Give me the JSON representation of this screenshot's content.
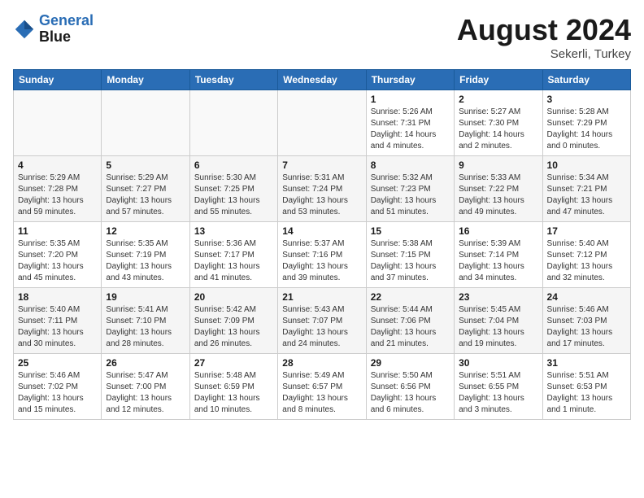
{
  "header": {
    "logo_line1": "General",
    "logo_line2": "Blue",
    "month_title": "August 2024",
    "subtitle": "Sekerli, Turkey"
  },
  "weekdays": [
    "Sunday",
    "Monday",
    "Tuesday",
    "Wednesday",
    "Thursday",
    "Friday",
    "Saturday"
  ],
  "weeks": [
    [
      {
        "day": "",
        "info": ""
      },
      {
        "day": "",
        "info": ""
      },
      {
        "day": "",
        "info": ""
      },
      {
        "day": "",
        "info": ""
      },
      {
        "day": "1",
        "info": "Sunrise: 5:26 AM\nSunset: 7:31 PM\nDaylight: 14 hours\nand 4 minutes."
      },
      {
        "day": "2",
        "info": "Sunrise: 5:27 AM\nSunset: 7:30 PM\nDaylight: 14 hours\nand 2 minutes."
      },
      {
        "day": "3",
        "info": "Sunrise: 5:28 AM\nSunset: 7:29 PM\nDaylight: 14 hours\nand 0 minutes."
      }
    ],
    [
      {
        "day": "4",
        "info": "Sunrise: 5:29 AM\nSunset: 7:28 PM\nDaylight: 13 hours\nand 59 minutes."
      },
      {
        "day": "5",
        "info": "Sunrise: 5:29 AM\nSunset: 7:27 PM\nDaylight: 13 hours\nand 57 minutes."
      },
      {
        "day": "6",
        "info": "Sunrise: 5:30 AM\nSunset: 7:25 PM\nDaylight: 13 hours\nand 55 minutes."
      },
      {
        "day": "7",
        "info": "Sunrise: 5:31 AM\nSunset: 7:24 PM\nDaylight: 13 hours\nand 53 minutes."
      },
      {
        "day": "8",
        "info": "Sunrise: 5:32 AM\nSunset: 7:23 PM\nDaylight: 13 hours\nand 51 minutes."
      },
      {
        "day": "9",
        "info": "Sunrise: 5:33 AM\nSunset: 7:22 PM\nDaylight: 13 hours\nand 49 minutes."
      },
      {
        "day": "10",
        "info": "Sunrise: 5:34 AM\nSunset: 7:21 PM\nDaylight: 13 hours\nand 47 minutes."
      }
    ],
    [
      {
        "day": "11",
        "info": "Sunrise: 5:35 AM\nSunset: 7:20 PM\nDaylight: 13 hours\nand 45 minutes."
      },
      {
        "day": "12",
        "info": "Sunrise: 5:35 AM\nSunset: 7:19 PM\nDaylight: 13 hours\nand 43 minutes."
      },
      {
        "day": "13",
        "info": "Sunrise: 5:36 AM\nSunset: 7:17 PM\nDaylight: 13 hours\nand 41 minutes."
      },
      {
        "day": "14",
        "info": "Sunrise: 5:37 AM\nSunset: 7:16 PM\nDaylight: 13 hours\nand 39 minutes."
      },
      {
        "day": "15",
        "info": "Sunrise: 5:38 AM\nSunset: 7:15 PM\nDaylight: 13 hours\nand 37 minutes."
      },
      {
        "day": "16",
        "info": "Sunrise: 5:39 AM\nSunset: 7:14 PM\nDaylight: 13 hours\nand 34 minutes."
      },
      {
        "day": "17",
        "info": "Sunrise: 5:40 AM\nSunset: 7:12 PM\nDaylight: 13 hours\nand 32 minutes."
      }
    ],
    [
      {
        "day": "18",
        "info": "Sunrise: 5:40 AM\nSunset: 7:11 PM\nDaylight: 13 hours\nand 30 minutes."
      },
      {
        "day": "19",
        "info": "Sunrise: 5:41 AM\nSunset: 7:10 PM\nDaylight: 13 hours\nand 28 minutes."
      },
      {
        "day": "20",
        "info": "Sunrise: 5:42 AM\nSunset: 7:09 PM\nDaylight: 13 hours\nand 26 minutes."
      },
      {
        "day": "21",
        "info": "Sunrise: 5:43 AM\nSunset: 7:07 PM\nDaylight: 13 hours\nand 24 minutes."
      },
      {
        "day": "22",
        "info": "Sunrise: 5:44 AM\nSunset: 7:06 PM\nDaylight: 13 hours\nand 21 minutes."
      },
      {
        "day": "23",
        "info": "Sunrise: 5:45 AM\nSunset: 7:04 PM\nDaylight: 13 hours\nand 19 minutes."
      },
      {
        "day": "24",
        "info": "Sunrise: 5:46 AM\nSunset: 7:03 PM\nDaylight: 13 hours\nand 17 minutes."
      }
    ],
    [
      {
        "day": "25",
        "info": "Sunrise: 5:46 AM\nSunset: 7:02 PM\nDaylight: 13 hours\nand 15 minutes."
      },
      {
        "day": "26",
        "info": "Sunrise: 5:47 AM\nSunset: 7:00 PM\nDaylight: 13 hours\nand 12 minutes."
      },
      {
        "day": "27",
        "info": "Sunrise: 5:48 AM\nSunset: 6:59 PM\nDaylight: 13 hours\nand 10 minutes."
      },
      {
        "day": "28",
        "info": "Sunrise: 5:49 AM\nSunset: 6:57 PM\nDaylight: 13 hours\nand 8 minutes."
      },
      {
        "day": "29",
        "info": "Sunrise: 5:50 AM\nSunset: 6:56 PM\nDaylight: 13 hours\nand 6 minutes."
      },
      {
        "day": "30",
        "info": "Sunrise: 5:51 AM\nSunset: 6:55 PM\nDaylight: 13 hours\nand 3 minutes."
      },
      {
        "day": "31",
        "info": "Sunrise: 5:51 AM\nSunset: 6:53 PM\nDaylight: 13 hours\nand 1 minute."
      }
    ]
  ]
}
